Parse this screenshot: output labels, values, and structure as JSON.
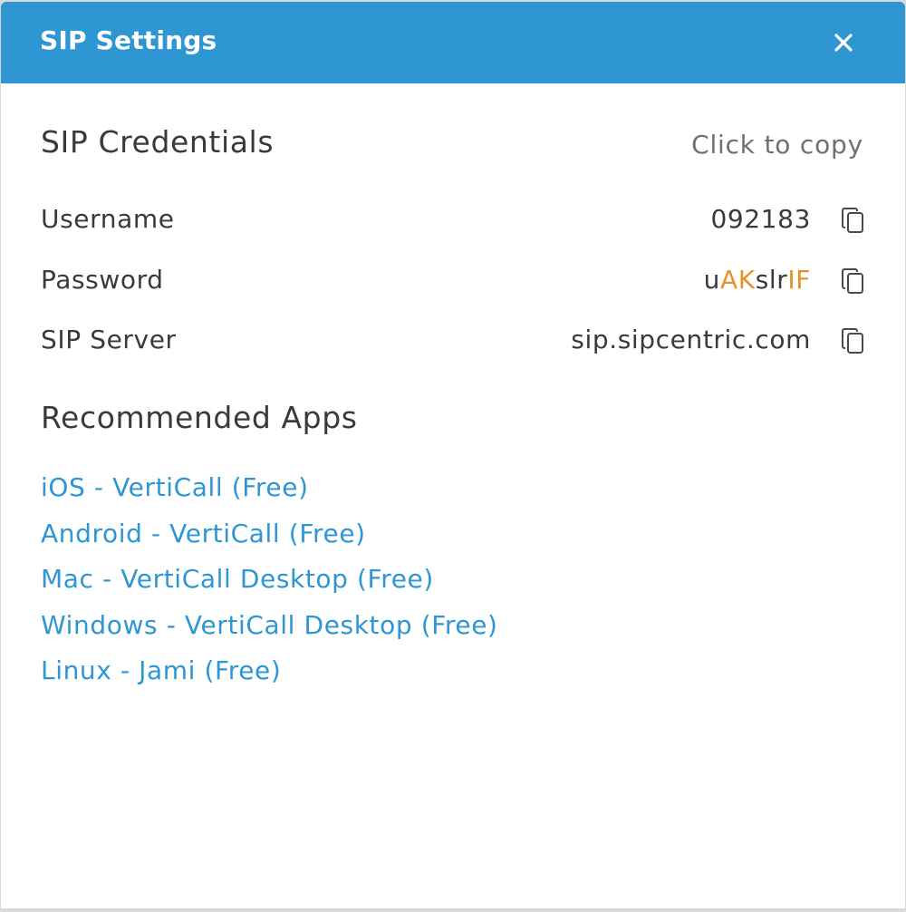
{
  "header": {
    "title": "SIP Settings",
    "close_icon": "close-icon"
  },
  "credentials": {
    "title": "SIP Credentials",
    "hint": "Click to copy",
    "rows": [
      {
        "label": "Username",
        "value": "092183",
        "icon": "copy-icon"
      },
      {
        "label": "Password",
        "value": "uAKslrIF",
        "icon": "copy-icon"
      },
      {
        "label": "SIP Server",
        "value": "sip.sipcentric.com",
        "icon": "copy-icon"
      }
    ]
  },
  "apps": {
    "title": "Recommended Apps",
    "links": [
      "iOS - VertiCall (Free)",
      "Android - VertiCall (Free)",
      "Mac - VertiCall Desktop (Free)",
      "Windows - VertiCall Desktop (Free)",
      "Linux - Jami (Free)"
    ]
  },
  "colors": {
    "header_bg": "#2d96d3",
    "link": "#2d96d3",
    "password_uppercase": "#e8912a",
    "text": "#3a3a3a",
    "hint": "#707070"
  }
}
